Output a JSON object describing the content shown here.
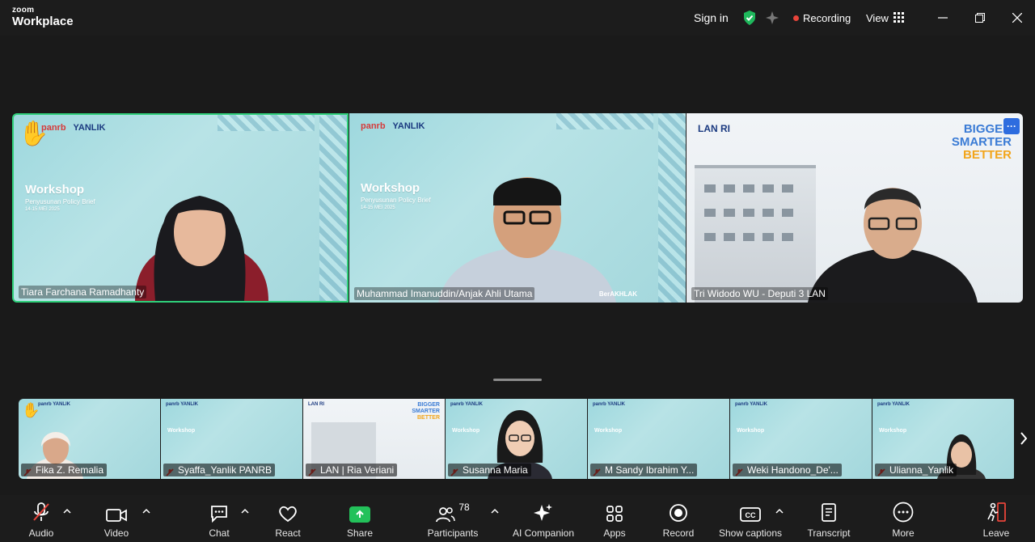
{
  "app": {
    "brand_small": "zoom",
    "brand_main": "Workplace"
  },
  "titlebar": {
    "sign_in": "Sign in",
    "recording": "Recording",
    "view": "View"
  },
  "tiles": [
    {
      "name": "Tiara Farchana Ramadhanty",
      "brand1": "panrb",
      "brand2": "YANLIK",
      "heading": "Workshop",
      "sub": "Penyusunan Policy Brief",
      "date": "14-15 MEI 2025"
    },
    {
      "name": "Muhammad Imanuddin/Anjak Ahli Utama",
      "brand1": "panrb",
      "brand2": "YANLIK",
      "heading": "Workshop",
      "sub": "Penyusunan Policy Brief",
      "date": "14-15 MEI 2025",
      "footer": "BerAKHLAK"
    },
    {
      "name": "Tri Widodo WU - Deputi 3 LAN",
      "logo": "LAN RI",
      "tag1": "BIGGER",
      "tag2": "SMARTER",
      "tag3": "BETTER"
    }
  ],
  "strip": [
    {
      "name": "Fika Z. Remalia",
      "type": "workshop",
      "hand": true
    },
    {
      "name": "Syaffa_Yanlik PANRB",
      "type": "workshop"
    },
    {
      "name": "LAN | Ria Veriani",
      "type": "lan"
    },
    {
      "name": "Susanna Maria",
      "type": "workshop"
    },
    {
      "name": "M Sandy Ibrahim Y...",
      "type": "workshop"
    },
    {
      "name": "Weki Handono_De'...",
      "type": "workshop"
    },
    {
      "name": "Ulianna_Yanlik",
      "type": "workshop"
    }
  ],
  "toolbar": {
    "audio": "Audio",
    "video": "Video",
    "chat": "Chat",
    "react": "React",
    "share": "Share",
    "participants": "Participants",
    "participants_count": "78",
    "ai": "AI Companion",
    "apps": "Apps",
    "record": "Record",
    "captions": "Show captions",
    "transcript": "Transcript",
    "more": "More",
    "leave": "Leave"
  },
  "colors": {
    "active_speaker": "#2fd07a",
    "share": "#23c15a",
    "recording": "#e8443a",
    "shield": "#1fb85c"
  }
}
